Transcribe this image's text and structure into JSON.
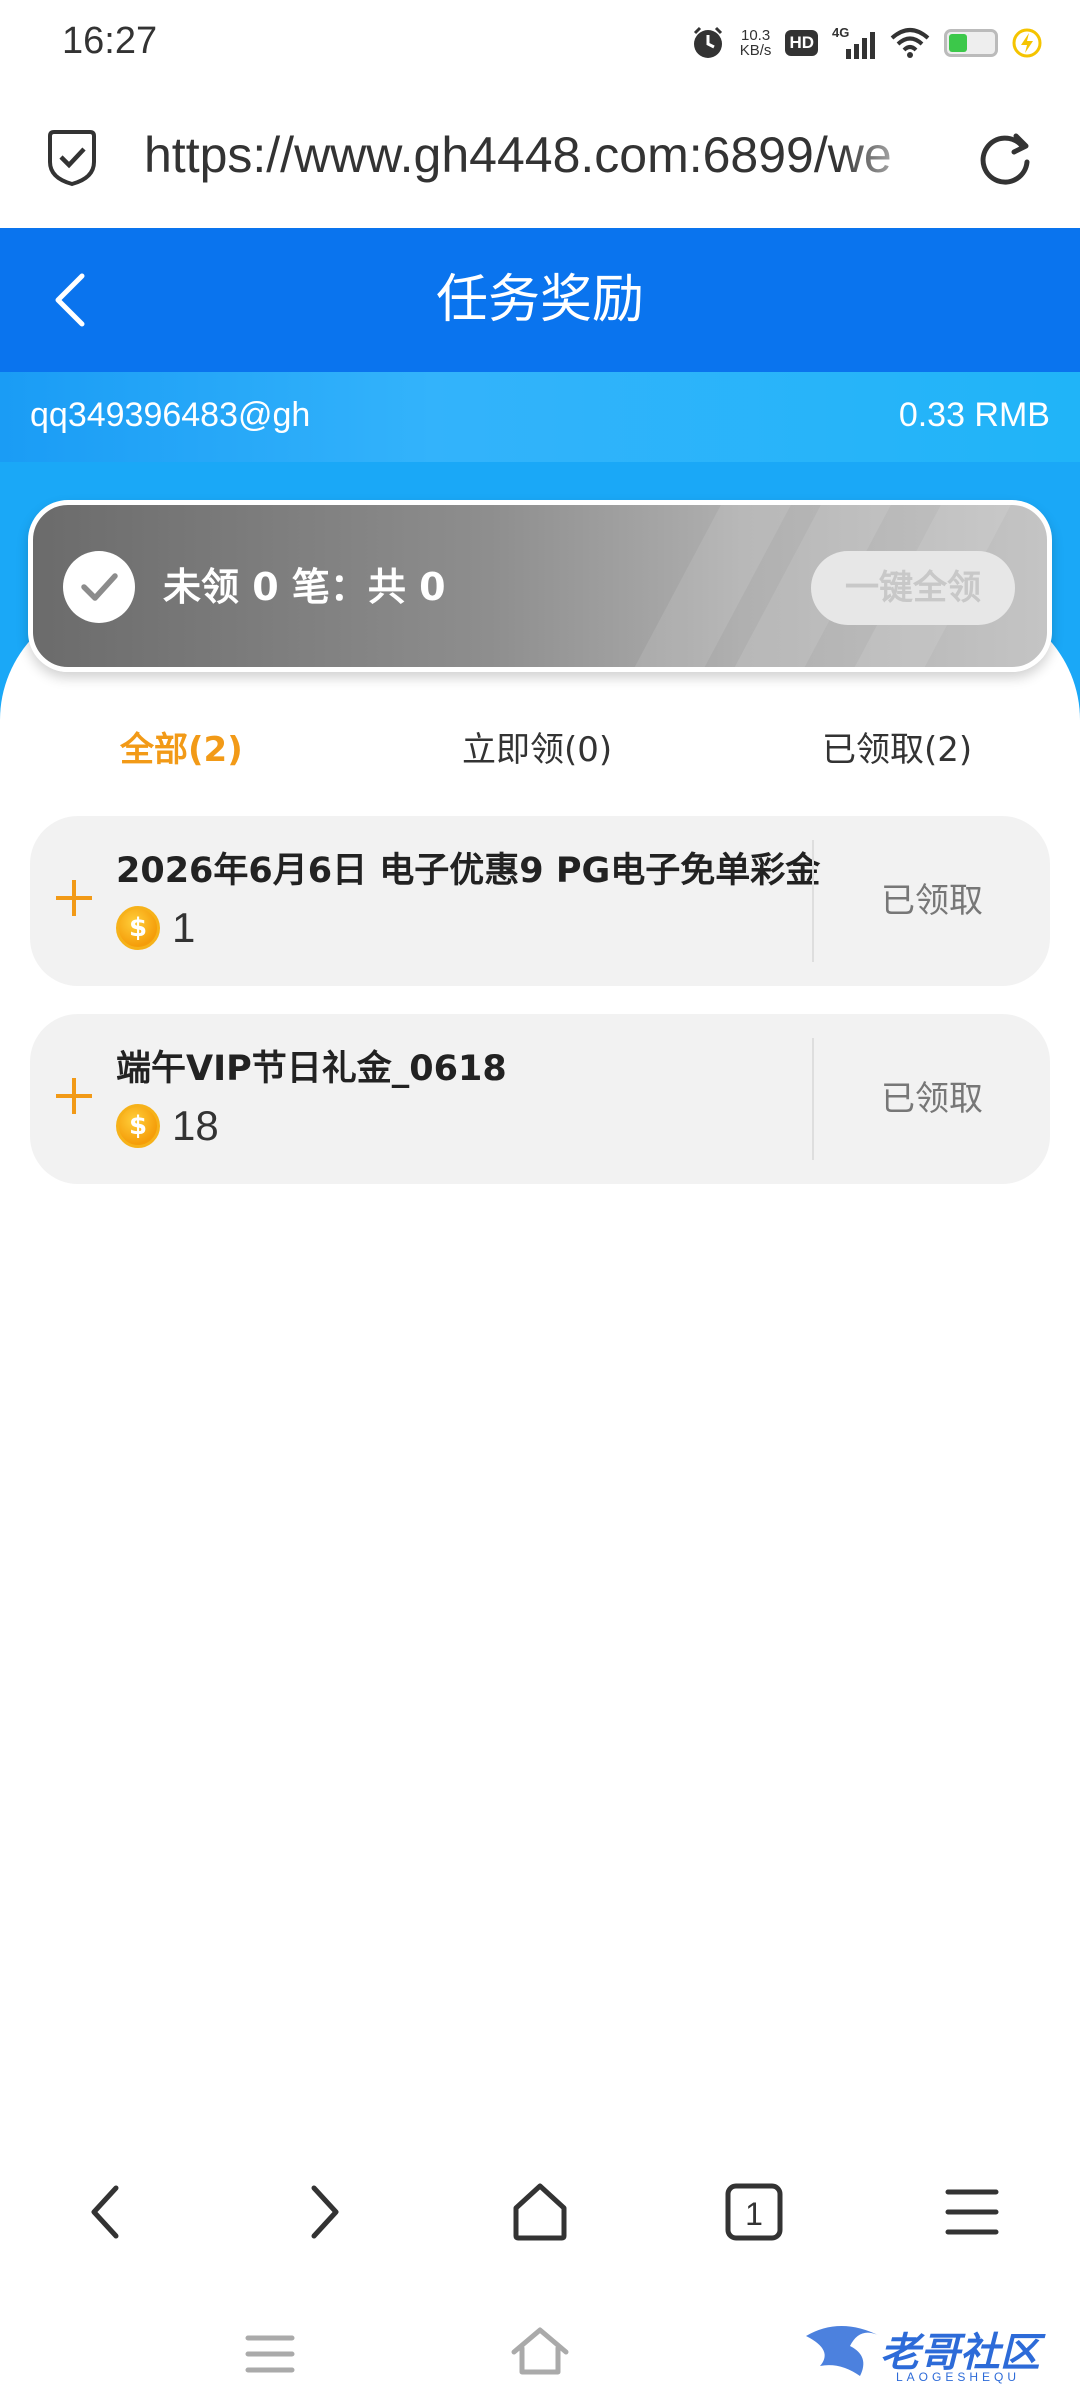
{
  "status_bar": {
    "time": "16:27",
    "net_speed_value": "10.3",
    "net_speed_unit": "KB/s",
    "hd_label": "HD",
    "network_label": "4G"
  },
  "browser": {
    "url": "https://www.gh4448.com:6899/we",
    "tab_count": "1"
  },
  "header": {
    "title": "任务奖励"
  },
  "account": {
    "username": "qq349396483@gh",
    "balance": "0.33 RMB"
  },
  "summary": {
    "text": "未领 0 笔：共 0",
    "claim_all_label": "一键全领"
  },
  "tabs": [
    {
      "label": "全部(2)",
      "active": true
    },
    {
      "label": "立即领(0)",
      "active": false
    },
    {
      "label": "已领取(2)",
      "active": false
    }
  ],
  "rewards": [
    {
      "title": "2026年6月6日 电子优惠9 PG电子免单彩金",
      "amount": "1",
      "status": "已领取"
    },
    {
      "title": "端午VIP节日礼金_0618",
      "amount": "18",
      "status": "已领取"
    }
  ],
  "watermark": {
    "text": "老哥社区",
    "sub": "LAOGESHEQU"
  },
  "colors": {
    "header_blue": "#0a74ee",
    "strip_blue": "#1aa8f7",
    "accent_orange": "#f29a17"
  }
}
